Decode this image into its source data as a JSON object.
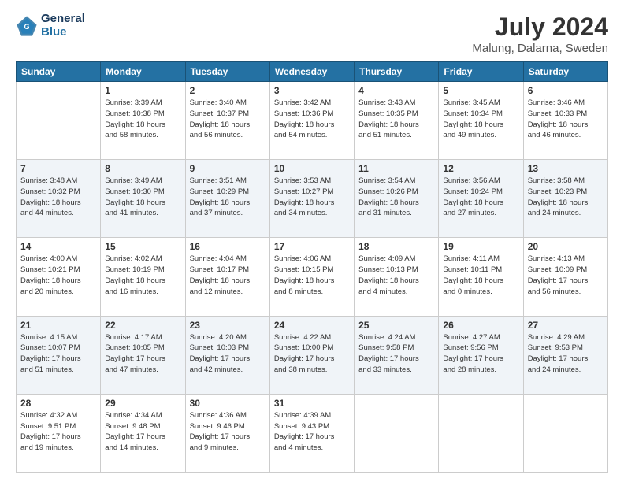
{
  "header": {
    "logo_general": "General",
    "logo_blue": "Blue",
    "month_year": "July 2024",
    "location": "Malung, Dalarna, Sweden"
  },
  "days_of_week": [
    "Sunday",
    "Monday",
    "Tuesday",
    "Wednesday",
    "Thursday",
    "Friday",
    "Saturday"
  ],
  "weeks": [
    [
      {
        "day": "",
        "info": ""
      },
      {
        "day": "1",
        "info": "Sunrise: 3:39 AM\nSunset: 10:38 PM\nDaylight: 18 hours\nand 58 minutes."
      },
      {
        "day": "2",
        "info": "Sunrise: 3:40 AM\nSunset: 10:37 PM\nDaylight: 18 hours\nand 56 minutes."
      },
      {
        "day": "3",
        "info": "Sunrise: 3:42 AM\nSunset: 10:36 PM\nDaylight: 18 hours\nand 54 minutes."
      },
      {
        "day": "4",
        "info": "Sunrise: 3:43 AM\nSunset: 10:35 PM\nDaylight: 18 hours\nand 51 minutes."
      },
      {
        "day": "5",
        "info": "Sunrise: 3:45 AM\nSunset: 10:34 PM\nDaylight: 18 hours\nand 49 minutes."
      },
      {
        "day": "6",
        "info": "Sunrise: 3:46 AM\nSunset: 10:33 PM\nDaylight: 18 hours\nand 46 minutes."
      }
    ],
    [
      {
        "day": "7",
        "info": "Sunrise: 3:48 AM\nSunset: 10:32 PM\nDaylight: 18 hours\nand 44 minutes."
      },
      {
        "day": "8",
        "info": "Sunrise: 3:49 AM\nSunset: 10:30 PM\nDaylight: 18 hours\nand 41 minutes."
      },
      {
        "day": "9",
        "info": "Sunrise: 3:51 AM\nSunset: 10:29 PM\nDaylight: 18 hours\nand 37 minutes."
      },
      {
        "day": "10",
        "info": "Sunrise: 3:53 AM\nSunset: 10:27 PM\nDaylight: 18 hours\nand 34 minutes."
      },
      {
        "day": "11",
        "info": "Sunrise: 3:54 AM\nSunset: 10:26 PM\nDaylight: 18 hours\nand 31 minutes."
      },
      {
        "day": "12",
        "info": "Sunrise: 3:56 AM\nSunset: 10:24 PM\nDaylight: 18 hours\nand 27 minutes."
      },
      {
        "day": "13",
        "info": "Sunrise: 3:58 AM\nSunset: 10:23 PM\nDaylight: 18 hours\nand 24 minutes."
      }
    ],
    [
      {
        "day": "14",
        "info": "Sunrise: 4:00 AM\nSunset: 10:21 PM\nDaylight: 18 hours\nand 20 minutes."
      },
      {
        "day": "15",
        "info": "Sunrise: 4:02 AM\nSunset: 10:19 PM\nDaylight: 18 hours\nand 16 minutes."
      },
      {
        "day": "16",
        "info": "Sunrise: 4:04 AM\nSunset: 10:17 PM\nDaylight: 18 hours\nand 12 minutes."
      },
      {
        "day": "17",
        "info": "Sunrise: 4:06 AM\nSunset: 10:15 PM\nDaylight: 18 hours\nand 8 minutes."
      },
      {
        "day": "18",
        "info": "Sunrise: 4:09 AM\nSunset: 10:13 PM\nDaylight: 18 hours\nand 4 minutes."
      },
      {
        "day": "19",
        "info": "Sunrise: 4:11 AM\nSunset: 10:11 PM\nDaylight: 18 hours\nand 0 minutes."
      },
      {
        "day": "20",
        "info": "Sunrise: 4:13 AM\nSunset: 10:09 PM\nDaylight: 17 hours\nand 56 minutes."
      }
    ],
    [
      {
        "day": "21",
        "info": "Sunrise: 4:15 AM\nSunset: 10:07 PM\nDaylight: 17 hours\nand 51 minutes."
      },
      {
        "day": "22",
        "info": "Sunrise: 4:17 AM\nSunset: 10:05 PM\nDaylight: 17 hours\nand 47 minutes."
      },
      {
        "day": "23",
        "info": "Sunrise: 4:20 AM\nSunset: 10:03 PM\nDaylight: 17 hours\nand 42 minutes."
      },
      {
        "day": "24",
        "info": "Sunrise: 4:22 AM\nSunset: 10:00 PM\nDaylight: 17 hours\nand 38 minutes."
      },
      {
        "day": "25",
        "info": "Sunrise: 4:24 AM\nSunset: 9:58 PM\nDaylight: 17 hours\nand 33 minutes."
      },
      {
        "day": "26",
        "info": "Sunrise: 4:27 AM\nSunset: 9:56 PM\nDaylight: 17 hours\nand 28 minutes."
      },
      {
        "day": "27",
        "info": "Sunrise: 4:29 AM\nSunset: 9:53 PM\nDaylight: 17 hours\nand 24 minutes."
      }
    ],
    [
      {
        "day": "28",
        "info": "Sunrise: 4:32 AM\nSunset: 9:51 PM\nDaylight: 17 hours\nand 19 minutes."
      },
      {
        "day": "29",
        "info": "Sunrise: 4:34 AM\nSunset: 9:48 PM\nDaylight: 17 hours\nand 14 minutes."
      },
      {
        "day": "30",
        "info": "Sunrise: 4:36 AM\nSunset: 9:46 PM\nDaylight: 17 hours\nand 9 minutes."
      },
      {
        "day": "31",
        "info": "Sunrise: 4:39 AM\nSunset: 9:43 PM\nDaylight: 17 hours\nand 4 minutes."
      },
      {
        "day": "",
        "info": ""
      },
      {
        "day": "",
        "info": ""
      },
      {
        "day": "",
        "info": ""
      }
    ]
  ]
}
